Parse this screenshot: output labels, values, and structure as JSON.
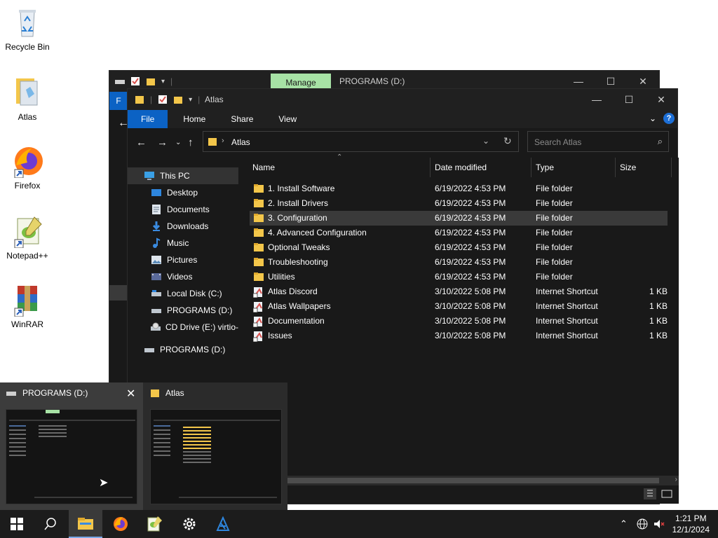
{
  "desktop": {
    "icons": [
      {
        "label": "Recycle Bin"
      },
      {
        "label": "Atlas"
      },
      {
        "label": "Firefox"
      },
      {
        "label": "Notepad++"
      },
      {
        "label": "WinRAR"
      }
    ]
  },
  "back_window": {
    "manage_tab": "Manage",
    "title": "PROGRAMS (D:)",
    "file_tab_initial": "F"
  },
  "window": {
    "title": "Atlas",
    "ribbon_tabs": [
      "File",
      "Home",
      "Share",
      "View"
    ],
    "address_path": "Atlas",
    "search_placeholder": "Search Atlas",
    "nav_pane": [
      {
        "label": "This PC",
        "icon": "pc-icon"
      },
      {
        "label": "Desktop",
        "icon": "desktop-icon"
      },
      {
        "label": "Documents",
        "icon": "documents-icon"
      },
      {
        "label": "Downloads",
        "icon": "downloads-icon"
      },
      {
        "label": "Music",
        "icon": "music-icon"
      },
      {
        "label": "Pictures",
        "icon": "pictures-icon"
      },
      {
        "label": "Videos",
        "icon": "videos-icon"
      },
      {
        "label": "Local Disk (C:)",
        "icon": "drive-icon"
      },
      {
        "label": "PROGRAMS (D:)",
        "icon": "drive-icon"
      },
      {
        "label": "CD Drive (E:) virtio-w",
        "icon": "cd-drive-icon"
      },
      {
        "label": "PROGRAMS (D:)",
        "icon": "drive-icon"
      }
    ],
    "columns": [
      "Name",
      "Date modified",
      "Type",
      "Size"
    ],
    "files": [
      {
        "name": "1. Install Software",
        "date": "6/19/2022 4:53 PM",
        "type": "File folder",
        "size": "",
        "kind": "folder"
      },
      {
        "name": "2. Install Drivers",
        "date": "6/19/2022 4:53 PM",
        "type": "File folder",
        "size": "",
        "kind": "folder"
      },
      {
        "name": "3. Configuration",
        "date": "6/19/2022 4:53 PM",
        "type": "File folder",
        "size": "",
        "kind": "folder"
      },
      {
        "name": "4. Advanced Configuration",
        "date": "6/19/2022 4:53 PM",
        "type": "File folder",
        "size": "",
        "kind": "folder"
      },
      {
        "name": "Optional Tweaks",
        "date": "6/19/2022 4:53 PM",
        "type": "File folder",
        "size": "",
        "kind": "folder"
      },
      {
        "name": "Troubleshooting",
        "date": "6/19/2022 4:53 PM",
        "type": "File folder",
        "size": "",
        "kind": "folder"
      },
      {
        "name": "Utilities",
        "date": "6/19/2022 4:53 PM",
        "type": "File folder",
        "size": "",
        "kind": "folder"
      },
      {
        "name": "Atlas Discord",
        "date": "3/10/2022 5:08 PM",
        "type": "Internet Shortcut",
        "size": "1 KB",
        "kind": "shortcut"
      },
      {
        "name": "Atlas Wallpapers",
        "date": "3/10/2022 5:08 PM",
        "type": "Internet Shortcut",
        "size": "1 KB",
        "kind": "shortcut"
      },
      {
        "name": "Documentation",
        "date": "3/10/2022 5:08 PM",
        "type": "Internet Shortcut",
        "size": "1 KB",
        "kind": "shortcut"
      },
      {
        "name": "Issues",
        "date": "3/10/2022 5:08 PM",
        "type": "Internet Shortcut",
        "size": "1 KB",
        "kind": "shortcut"
      }
    ],
    "selected_row": 2
  },
  "thumbnails": [
    {
      "title": "PROGRAMS (D:)"
    },
    {
      "title": "Atlas"
    }
  ],
  "taskbar": {
    "items": [
      "start-icon",
      "search-icon",
      "file-explorer-icon",
      "firefox-icon",
      "notepadpp-icon",
      "settings-icon",
      "atlas-icon"
    ],
    "time": "1:21 PM",
    "date": "12/1/2024"
  },
  "colors": {
    "accent": "#0b62c4",
    "manage_tab": "#a7e2a5",
    "folder": "#f3c64a",
    "window_bg": "#191919"
  }
}
